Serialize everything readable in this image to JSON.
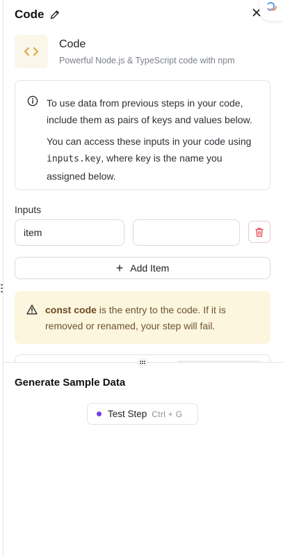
{
  "header": {
    "title": "Code"
  },
  "app": {
    "name": "Code",
    "description": "Powerful Node.js & TypeScript code with npm"
  },
  "info": {
    "line1": "To use data from previous steps in your code, include them as pairs of keys and values below.",
    "line2_before": "You can access these inputs in your code using ",
    "line2_code": "inputs.key",
    "line2_after": ", where key is the name you assigned below."
  },
  "inputs": {
    "label": "Inputs",
    "rows": [
      {
        "key": "item",
        "value": ""
      }
    ],
    "add_label": "Add Item"
  },
  "warning": {
    "bold": "const code",
    "text": " is the entry to the code. If it is removed or renamed, your step will fail."
  },
  "sample": {
    "title": "Generate Sample Data",
    "button_label": "Test Step",
    "shortcut": "Ctrl + G"
  },
  "colors": {
    "accent_dot": "#6e42e5",
    "warning_bg": "#fdf6df",
    "delete": "#e5484d",
    "app_icon": "#e0a43a"
  },
  "icons": [
    "edit-pencil-icon",
    "close-icon",
    "code-brackets-icon",
    "info-icon",
    "trash-icon",
    "plus-icon",
    "warning-triangle-icon",
    "drag-handle-icon"
  ]
}
